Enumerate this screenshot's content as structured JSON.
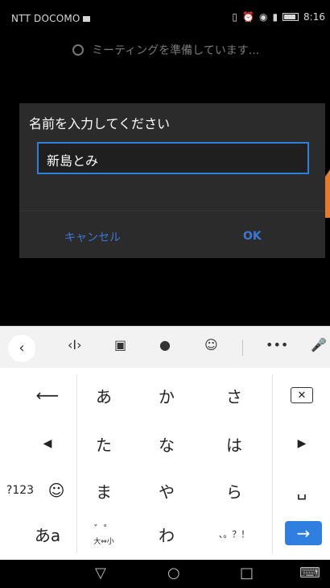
{
  "status_bar": {
    "carrier": "NTT DOCOMO",
    "time": "8:16"
  },
  "preparing_text": "ミーティングを準備しています...",
  "dialog": {
    "title": "名前を入力してください",
    "name_value": "新島とみ",
    "cancel_label": "キャンセル",
    "ok_label": "OK"
  },
  "keyboard": {
    "toolbar": [
      "back-chevron",
      "cursor-move",
      "clipboard",
      "palette",
      "emoji-sticker",
      "more",
      "microphone"
    ],
    "rows": [
      [
        "←",
        "あ",
        "か",
        "さ",
        "⌫"
      ],
      [
        "◀",
        "た",
        "な",
        "は",
        "▶"
      ],
      [
        "?123",
        "☺",
        "ま",
        "や",
        "ら",
        "␣"
      ],
      [
        "あa",
        "゛゜",
        "わ",
        "、。？！",
        "→"
      ]
    ],
    "labels": {
      "a": "あ",
      "ka": "か",
      "sa": "さ",
      "ta": "た",
      "na": "な",
      "ha": "は",
      "ma": "ま",
      "ya": "や",
      "ra": "ら",
      "wa": "わ",
      "num": "?123",
      "kana": "あa",
      "dakuten": "゛゜",
      "dakuten_sub": "大⇔小",
      "punct": "、。？！"
    }
  },
  "colors": {
    "accent": "#2f80d8",
    "dialog_bg": "#2b2b2b",
    "button_text": "#3b78d6",
    "orange": "#e87b2a"
  }
}
